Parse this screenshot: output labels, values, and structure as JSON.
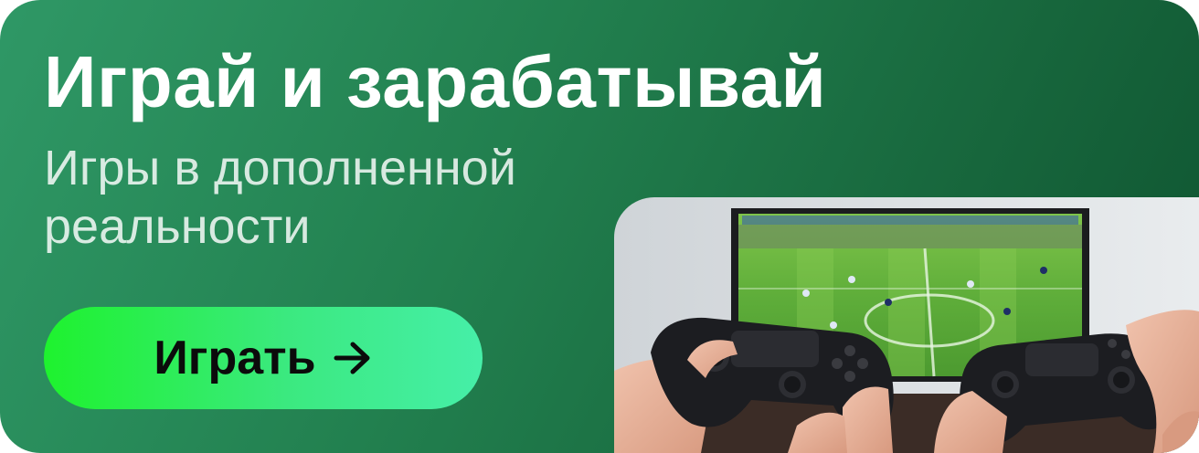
{
  "banner": {
    "title": "Играй и зарабатывай",
    "subtitle": "Игры в дополненной реальности",
    "cta_label": "Играть",
    "cta_icon": "arrow-right-icon",
    "photo_description": "gamepad-photo",
    "colors": {
      "background_start": "#2f9866",
      "background_end": "#0f5431",
      "button_start": "#1ef22e",
      "button_end": "#46efa8",
      "title": "#ffffff",
      "button_text": "#0b0b0b"
    }
  }
}
